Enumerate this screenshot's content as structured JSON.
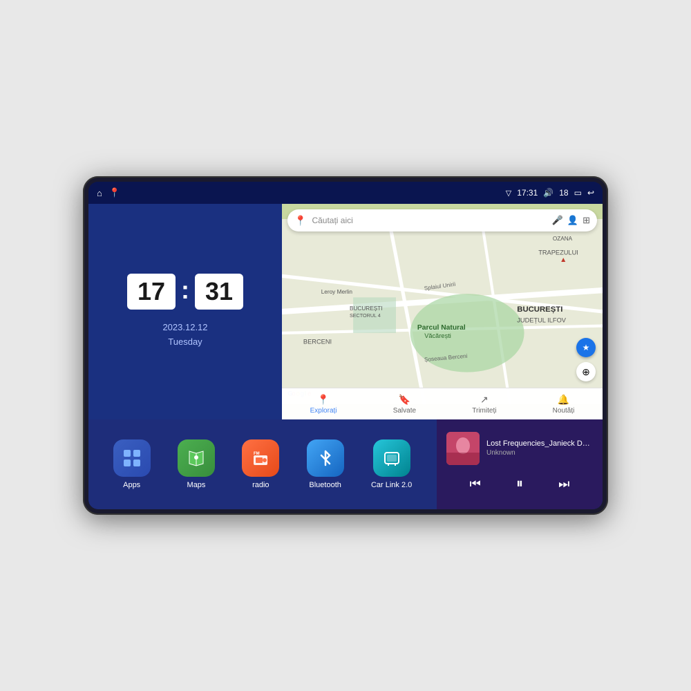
{
  "device": {
    "status_bar": {
      "left_icons": [
        "home",
        "maps"
      ],
      "time": "17:31",
      "volume_icon": "🔊",
      "battery_level": "18",
      "battery_icon": "🔋",
      "back_icon": "↩"
    },
    "clock_widget": {
      "hour": "17",
      "minute": "31",
      "date": "2023.12.12",
      "day": "Tuesday"
    },
    "map_widget": {
      "search_placeholder": "Căutați aici",
      "nav_items": [
        {
          "label": "Explorați",
          "active": true
        },
        {
          "label": "Salvate",
          "active": false
        },
        {
          "label": "Trimiteți",
          "active": false
        },
        {
          "label": "Noutăți",
          "active": false
        }
      ]
    },
    "apps": [
      {
        "id": "apps",
        "label": "Apps",
        "icon_class": "icon-apps"
      },
      {
        "id": "maps",
        "label": "Maps",
        "icon_class": "icon-maps"
      },
      {
        "id": "radio",
        "label": "radio",
        "icon_class": "icon-radio"
      },
      {
        "id": "bluetooth",
        "label": "Bluetooth",
        "icon_class": "icon-bluetooth"
      },
      {
        "id": "carlink",
        "label": "Car Link 2.0",
        "icon_class": "icon-carlink"
      }
    ],
    "music_player": {
      "title": "Lost Frequencies_Janieck Devy-...",
      "artist": "Unknown",
      "controls": {
        "prev": "⏮",
        "play": "⏸",
        "next": "⏭"
      }
    }
  }
}
